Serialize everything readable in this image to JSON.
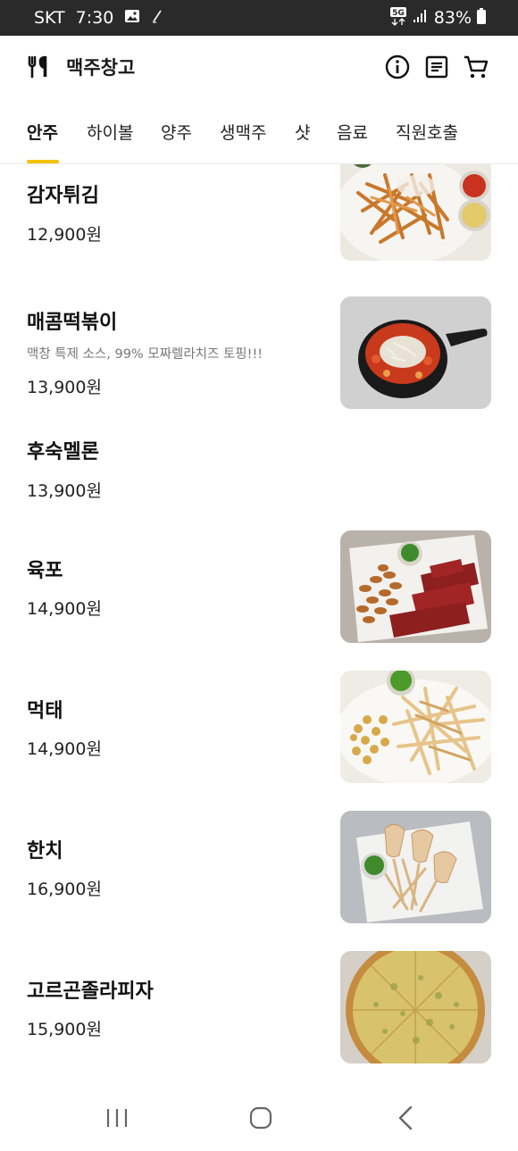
{
  "status_bar": {
    "carrier": "SKT",
    "time": "7:30",
    "network": "5G",
    "battery": "83%"
  },
  "header": {
    "title": "맥주창고",
    "icons": [
      "fork-knife-icon",
      "info-icon",
      "receipt-icon",
      "cart-icon"
    ]
  },
  "tabs": [
    {
      "label": "안주",
      "active": true
    },
    {
      "label": "하이볼",
      "active": false
    },
    {
      "label": "양주",
      "active": false
    },
    {
      "label": "생맥주",
      "active": false
    },
    {
      "label": "샷",
      "active": false
    },
    {
      "label": "음료",
      "active": false
    },
    {
      "label": "직원호출",
      "active": false
    }
  ],
  "menu_items": [
    {
      "name": "감자튀김",
      "description": "",
      "price": "12,900원",
      "photo": "fries"
    },
    {
      "name": "매콤떡볶이",
      "description": "맥창 특제 소스, 99% 모짜렐라치즈 토핑!!!",
      "price": "13,900원",
      "photo": "tteokbokki"
    },
    {
      "name": "후숙멜론",
      "description": "",
      "price": "13,900원",
      "photo": ""
    },
    {
      "name": "육포",
      "description": "",
      "price": "14,900원",
      "photo": "jerky"
    },
    {
      "name": "먹태",
      "description": "",
      "price": "14,900원",
      "photo": "pollock"
    },
    {
      "name": "한치",
      "description": "",
      "price": "16,900원",
      "photo": "squid"
    },
    {
      "name": "고르곤졸라피자",
      "description": "",
      "price": "15,900원",
      "photo": "pizza"
    }
  ],
  "colors": {
    "accent": "#f4c20d",
    "status_bar": "#2a2a2a",
    "text_primary": "#111111",
    "text_secondary": "#777777"
  }
}
